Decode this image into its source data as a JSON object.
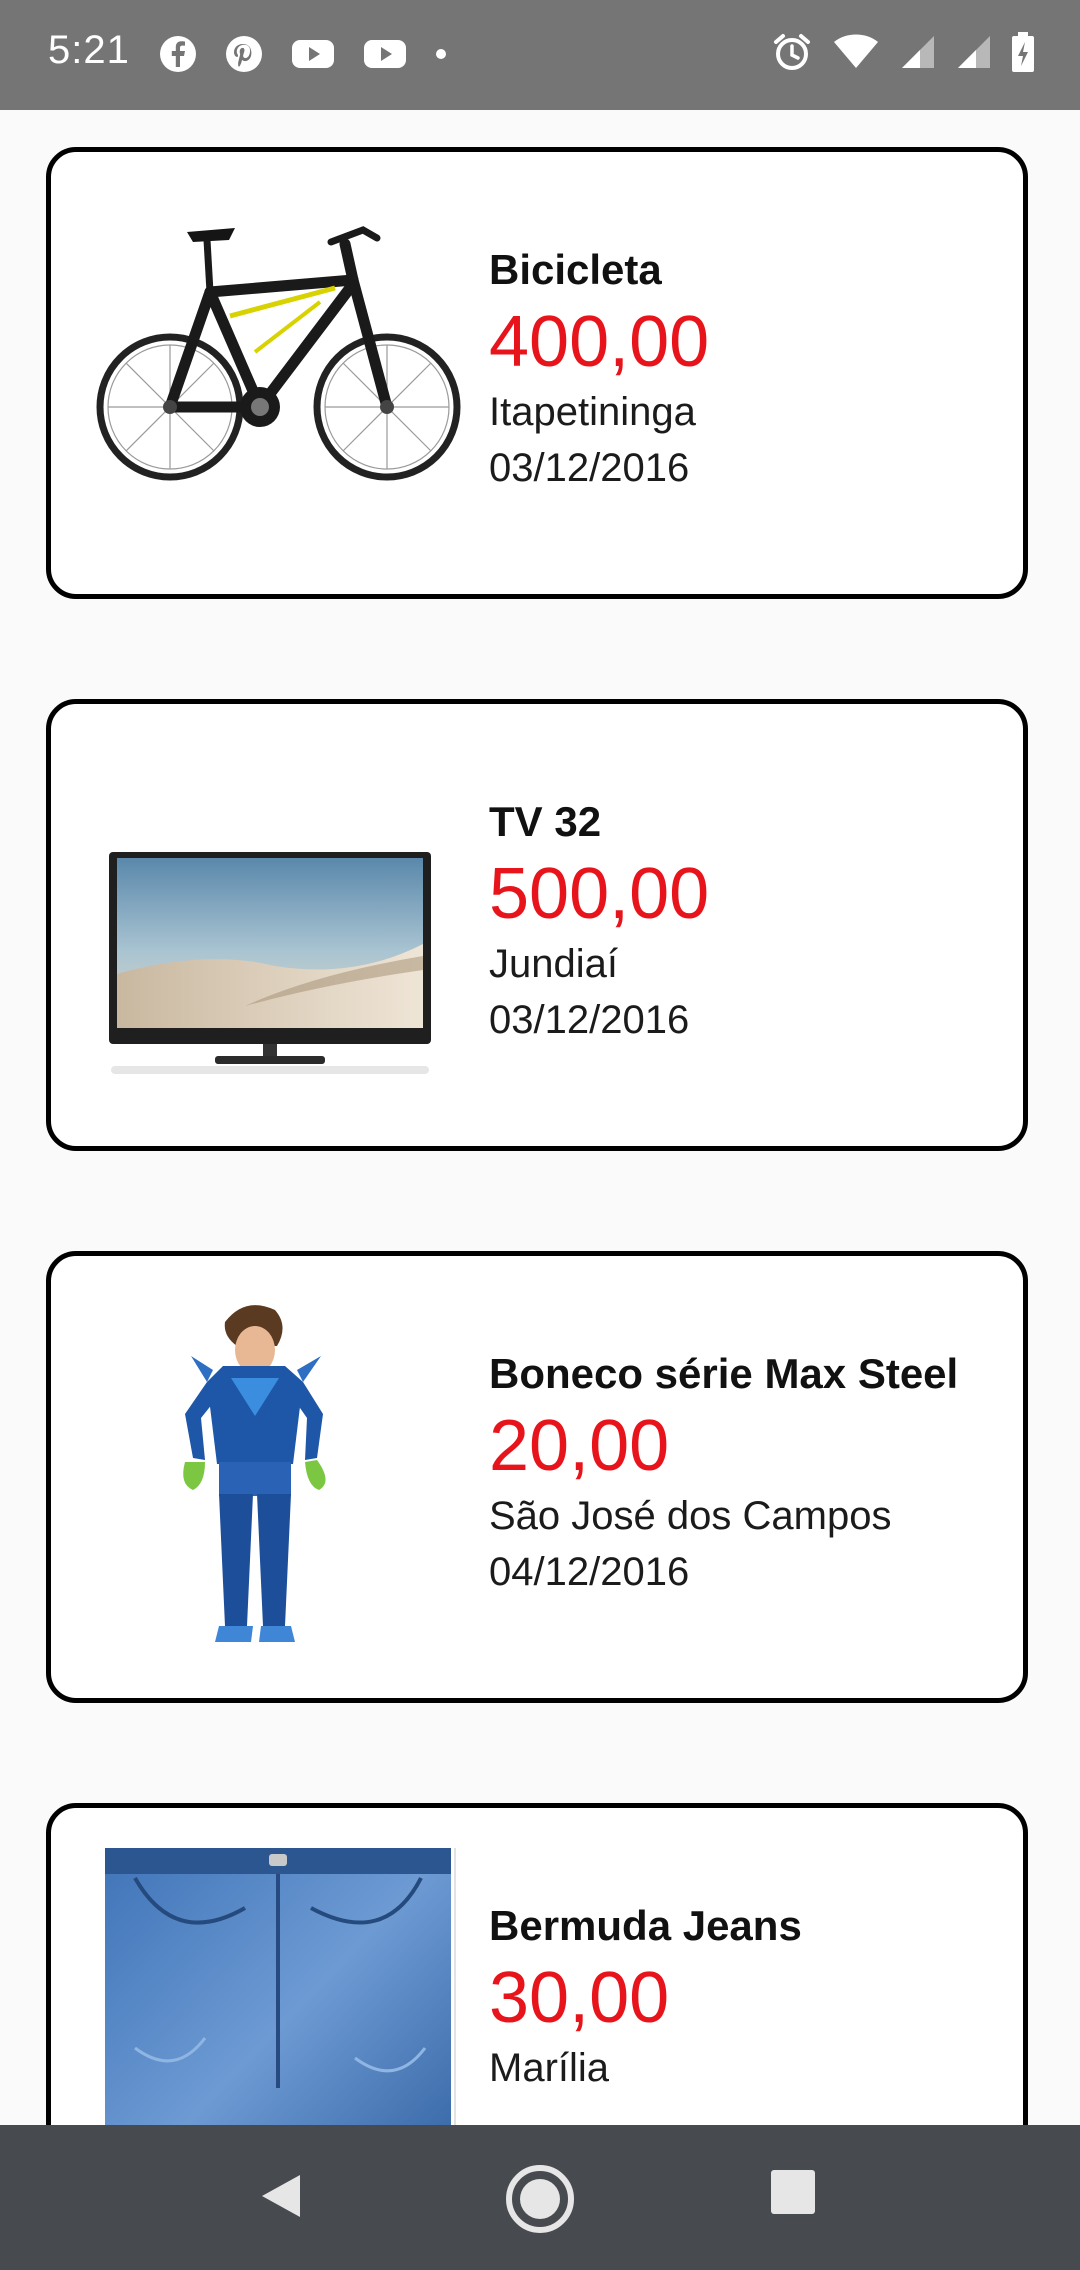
{
  "status_bar": {
    "time": "5:21",
    "left_icons": [
      "facebook-icon",
      "pinterest-icon",
      "youtube-icon",
      "youtube-icon",
      "dot-icon"
    ],
    "right_icons": [
      "alarm-icon",
      "wifi-icon",
      "signal-icon",
      "signal-icon",
      "battery-icon"
    ]
  },
  "listings": [
    {
      "title": "Bicicleta",
      "price": "400,00",
      "city": "Itapetininga",
      "date": "03/12/2016",
      "image": "bicycle"
    },
    {
      "title": "TV 32",
      "price": "500,00",
      "city": "Jundiaí",
      "date": "03/12/2016",
      "image": "tv"
    },
    {
      "title": "Boneco série Max Steel",
      "price": "20,00",
      "city": "São José dos Campos",
      "date": "04/12/2016",
      "image": "action-figure"
    },
    {
      "title": "Bermuda Jeans",
      "price": "30,00",
      "city": "Marília",
      "date": "",
      "image": "jeans-shorts"
    }
  ],
  "colors": {
    "price": "#e8141b",
    "status_bar": "#757575",
    "nav_bar": "#474b4f",
    "card_border": "#000000"
  },
  "nav_bar": {
    "buttons": [
      "back-icon",
      "home-icon",
      "recents-icon"
    ]
  }
}
